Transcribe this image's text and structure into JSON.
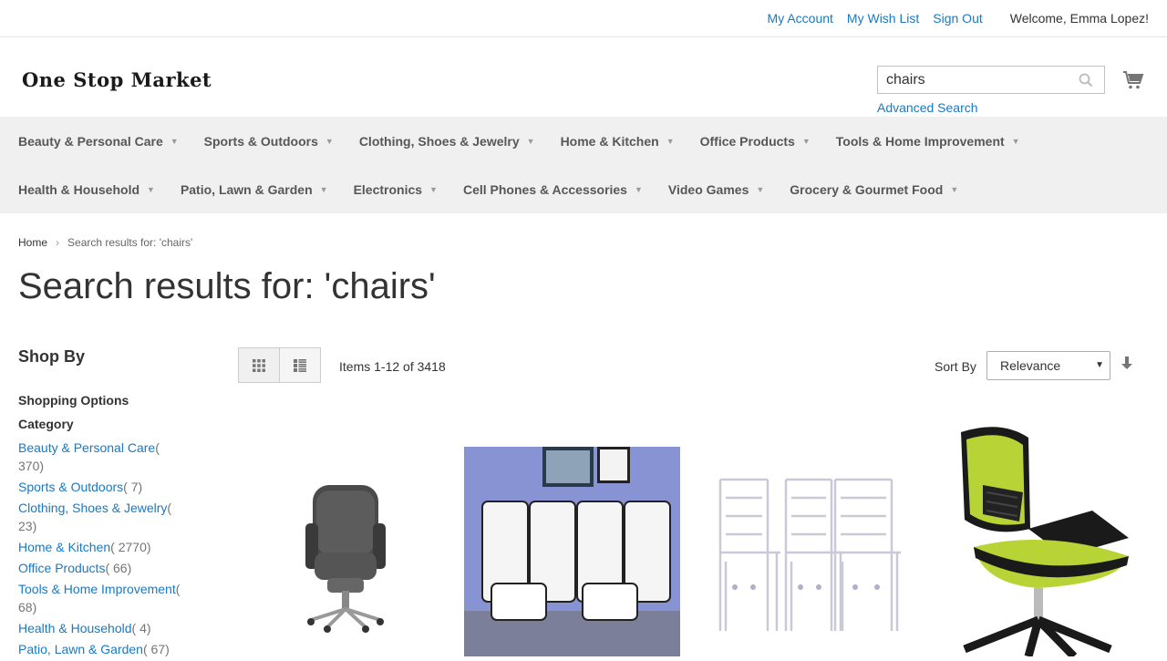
{
  "topbar": {
    "my_account": "My Account",
    "wish_list": "My Wish List",
    "sign_out": "Sign Out",
    "welcome": "Welcome, Emma Lopez!"
  },
  "header": {
    "logo_text": "One Stop Market",
    "search_value": "chairs",
    "advanced_search": "Advanced Search"
  },
  "nav": {
    "row1": [
      "Beauty & Personal Care",
      "Sports & Outdoors",
      "Clothing, Shoes & Jewelry",
      "Home & Kitchen",
      "Office Products",
      "Tools & Home Improvement"
    ],
    "row2": [
      "Health & Household",
      "Patio, Lawn & Garden",
      "Electronics",
      "Cell Phones & Accessories",
      "Video Games",
      "Grocery & Gourmet Food"
    ]
  },
  "breadcrumb": {
    "home": "Home",
    "current": "Search results for: 'chairs'"
  },
  "page_title": "Search results for: 'chairs'",
  "sidebar": {
    "shop_by": "Shop By",
    "shopping_options": "Shopping Options",
    "category": "Category",
    "categories": [
      {
        "name": "Beauty & Personal Care",
        "count": "( 370)"
      },
      {
        "name": "Sports & Outdoors",
        "count": "( 7)"
      },
      {
        "name": "Clothing, Shoes & Jewelry",
        "count": "( 23)"
      },
      {
        "name": "Home & Kitchen",
        "count": "( 2770)"
      },
      {
        "name": "Office Products",
        "count": "( 66)"
      },
      {
        "name": "Tools & Home Improvement",
        "count": "( 68)"
      },
      {
        "name": "Health & Household",
        "count": "( 4)"
      },
      {
        "name": "Patio, Lawn & Garden",
        "count": "( 67)"
      }
    ]
  },
  "toolbar": {
    "amount": "Items 1-12 of 3418",
    "sort_label": "Sort By",
    "sort_value": "Relevance"
  },
  "products": [
    {
      "image": "gray-leather-executive-office-chair"
    },
    {
      "image": "white-dining-chairs-set"
    },
    {
      "image": "clear-acrylic-chiavari-chairs"
    },
    {
      "image": "green-mesh-office-chair"
    }
  ],
  "colors": {
    "link": "#1979c3",
    "nav_bg": "#f0f0f0"
  }
}
